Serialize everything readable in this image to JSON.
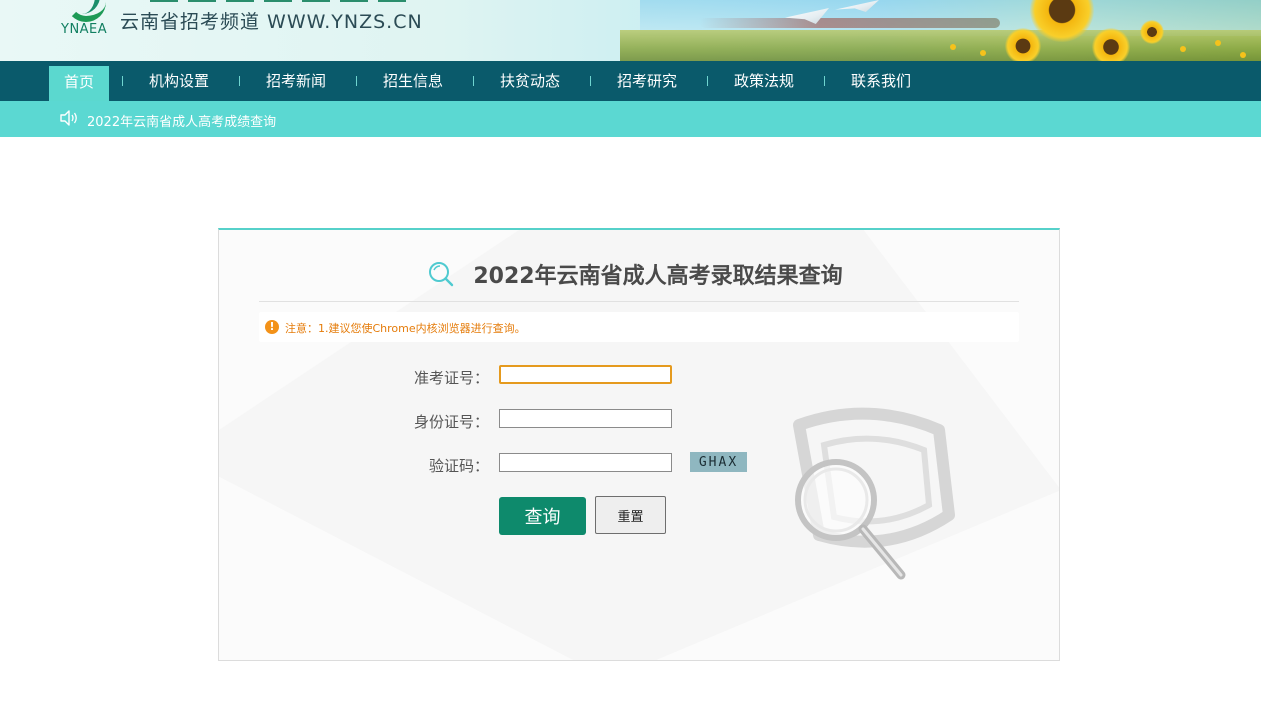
{
  "header": {
    "logo_text": "YNAEA",
    "site_title": "云南省招考频道  WWW.YNZS.CN"
  },
  "nav": {
    "items": [
      {
        "label": "首页",
        "active": true
      },
      {
        "label": "机构设置"
      },
      {
        "label": "招考新闻"
      },
      {
        "label": "招生信息"
      },
      {
        "label": "扶贫动态"
      },
      {
        "label": "招考研究"
      },
      {
        "label": "政策法规"
      },
      {
        "label": "联系我们"
      }
    ]
  },
  "ticker": {
    "text": "2022年云南省成人高考成绩查询",
    "icon": "speaker-icon"
  },
  "panel": {
    "title": "2022年云南省成人高考录取结果查询",
    "title_icon": "search-icon",
    "notice": "注意：1.建议您使Chrome内核浏览器进行查询。",
    "fields": {
      "exam_number_label": "准考证号：",
      "exam_number_value": "",
      "id_number_label": "身份证号：",
      "id_number_value": "",
      "captcha_label": "验证码：",
      "captcha_value": ""
    },
    "captcha_code": "GHAX",
    "query_button": "查询",
    "reset_button": "重置"
  },
  "colors": {
    "nav_bg": "#0a5a6b",
    "accent": "#5bd8d2",
    "query_button": "#0e8a6c",
    "notice_text": "#e57c0b"
  }
}
